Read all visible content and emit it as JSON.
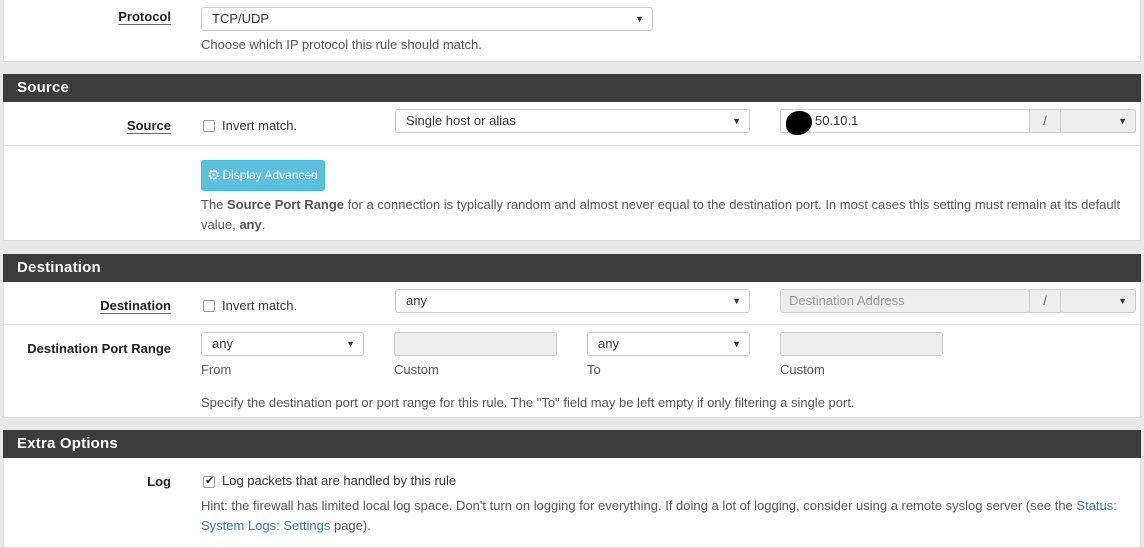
{
  "protocol": {
    "label": "Protocol",
    "selected": "TCP/UDP",
    "help": "Choose which IP protocol this rule should match."
  },
  "source": {
    "heading": "Source",
    "label": "Source",
    "invert_label": "Invert match.",
    "invert_checked": false,
    "type_selected": "Single host or alias",
    "address_value": "50.10.1",
    "slash": "/",
    "mask_selected": "",
    "advanced_button": "Display Advanced",
    "help_pre": "The ",
    "help_bold": "Source Port Range",
    "help_mid": " for a connection is typically random and almost never equal to the destination port. In most cases this setting must remain at its default value, ",
    "help_bold2": "any",
    "help_post": "."
  },
  "destination": {
    "heading": "Destination",
    "label": "Destination",
    "invert_label": "Invert match.",
    "invert_checked": false,
    "type_selected": "any",
    "address_placeholder": "Destination Address",
    "slash": "/",
    "mask_selected": "",
    "port_range_label": "Destination Port Range",
    "from_selected": "any",
    "from_label": "From",
    "from_custom_label": "Custom",
    "to_selected": "any",
    "to_label": "To",
    "to_custom_label": "Custom",
    "help": "Specify the destination port or port range for this rule. The \"To\" field may be left empty if only filtering a single port."
  },
  "extra": {
    "heading": "Extra Options",
    "log_label": "Log",
    "log_checkbox_label": "Log packets that are handled by this rule",
    "log_checked": true,
    "hint_pre": "Hint: the firewall has limited local log space. Don't turn on logging for everything. If doing a lot of logging, consider using a remote syslog server (see the ",
    "hint_link": "Status: System Logs: Settings",
    "hint_post": " page)."
  },
  "colors": {
    "heading_bg": "#3c3c3c",
    "button_bg": "#5bc0de",
    "link": "#337ab7"
  }
}
